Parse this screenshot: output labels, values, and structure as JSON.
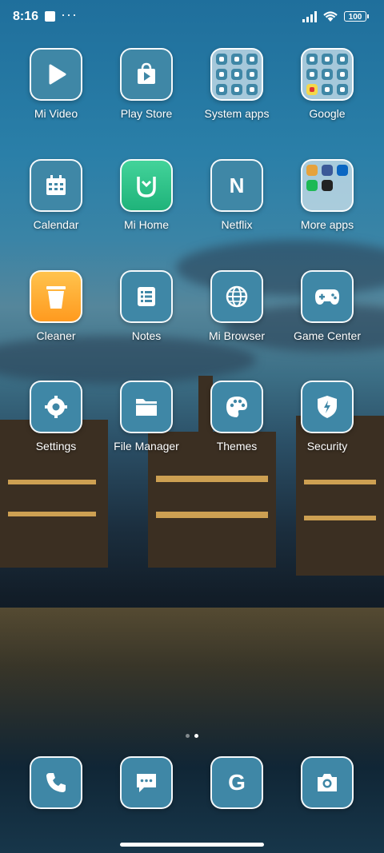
{
  "status": {
    "time": "8:16",
    "battery": "100"
  },
  "apps": [
    {
      "label": "Mi Video",
      "icon": "play-icon"
    },
    {
      "label": "Play Store",
      "icon": "play-store-icon"
    },
    {
      "label": "System apps",
      "icon": "folder-icon"
    },
    {
      "label": "Google",
      "icon": "folder-icon"
    },
    {
      "label": "Calendar",
      "icon": "calendar-icon"
    },
    {
      "label": "Mi Home",
      "icon": "mi-home-icon"
    },
    {
      "label": "Netflix",
      "icon": "netflix-icon"
    },
    {
      "label": "More apps",
      "icon": "folder-icon"
    },
    {
      "label": "Cleaner",
      "icon": "trash-icon"
    },
    {
      "label": "Notes",
      "icon": "notes-icon"
    },
    {
      "label": "Mi Browser",
      "icon": "globe-icon"
    },
    {
      "label": "Game Center",
      "icon": "gamepad-icon"
    },
    {
      "label": "Settings",
      "icon": "gear-icon"
    },
    {
      "label": "File Manager",
      "icon": "folder-file-icon"
    },
    {
      "label": "Themes",
      "icon": "palette-icon"
    },
    {
      "label": "Security",
      "icon": "shield-icon"
    }
  ],
  "dock": [
    {
      "icon": "phone-icon"
    },
    {
      "icon": "message-icon"
    },
    {
      "icon": "google-g-icon"
    },
    {
      "icon": "camera-icon"
    }
  ],
  "netflix_letter": "N",
  "google_letter": "G",
  "colors": {
    "tile": "#3f87a6",
    "mi_home": "#2fc288",
    "cleaner": "#ffb13a"
  }
}
